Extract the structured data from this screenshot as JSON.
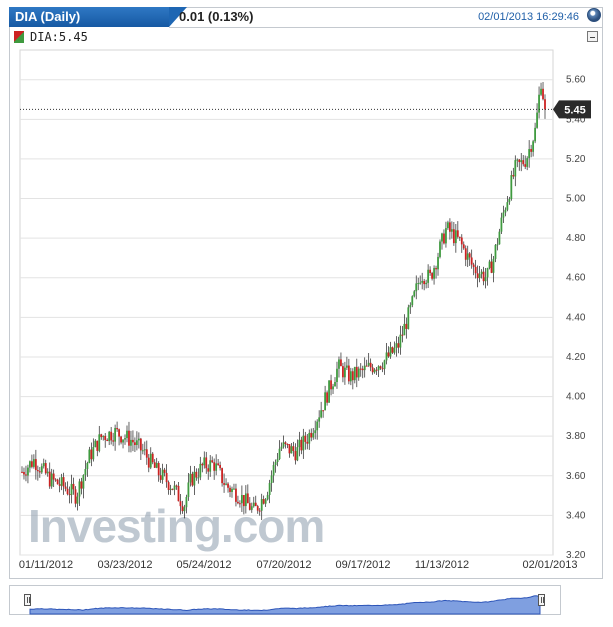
{
  "header": {
    "tab_title": "DIA (Daily)",
    "change": "0.01 (0.13%)",
    "timestamp": "02/01/2013 16:29:46"
  },
  "legend": {
    "label": "DIA:5.45"
  },
  "watermark": "Investing.com",
  "chart_data": {
    "type": "candlestick",
    "series_name": "DIA",
    "last_price_label": "5.45",
    "last_price": 5.45,
    "ylim": [
      3.2,
      5.7
    ],
    "y_ticks": [
      "3.20",
      "3.40",
      "3.60",
      "3.80",
      "4.00",
      "4.20",
      "4.40",
      "4.60",
      "4.80",
      "5.00",
      "5.20",
      "5.40",
      "5.60"
    ],
    "x_tick_labels": [
      "01/11/2012",
      "03/23/2012",
      "05/24/2012",
      "07/20/2012",
      "09/17/2012",
      "11/13/2012",
      "02/01/2013"
    ],
    "grid": "horizontal",
    "up_color": "#3f9a3f",
    "down_color": "#cc2222",
    "approx_close_series": [
      [
        "2012-01-11",
        3.62
      ],
      [
        "2012-01-20",
        3.68
      ],
      [
        "2012-02-01",
        3.58
      ],
      [
        "2012-02-10",
        3.55
      ],
      [
        "2012-02-20",
        3.5
      ],
      [
        "2012-03-01",
        3.7
      ],
      [
        "2012-03-10",
        3.8
      ],
      [
        "2012-03-20",
        3.82
      ],
      [
        "2012-04-01",
        3.78
      ],
      [
        "2012-04-10",
        3.72
      ],
      [
        "2012-04-20",
        3.62
      ],
      [
        "2012-05-01",
        3.55
      ],
      [
        "2012-05-10",
        3.45
      ],
      [
        "2012-05-15",
        3.58
      ],
      [
        "2012-05-24",
        3.65
      ],
      [
        "2012-06-01",
        3.66
      ],
      [
        "2012-06-10",
        3.55
      ],
      [
        "2012-06-20",
        3.5
      ],
      [
        "2012-07-01",
        3.42
      ],
      [
        "2012-07-10",
        3.52
      ],
      [
        "2012-07-20",
        3.75
      ],
      [
        "2012-08-01",
        3.72
      ],
      [
        "2012-08-10",
        3.8
      ],
      [
        "2012-08-20",
        3.95
      ],
      [
        "2012-09-01",
        4.15
      ],
      [
        "2012-09-10",
        4.1
      ],
      [
        "2012-09-17",
        4.12
      ],
      [
        "2012-09-25",
        4.15
      ],
      [
        "2012-10-05",
        4.18
      ],
      [
        "2012-10-15",
        4.25
      ],
      [
        "2012-10-25",
        4.45
      ],
      [
        "2012-11-01",
        4.62
      ],
      [
        "2012-11-08",
        4.6
      ],
      [
        "2012-11-13",
        4.7
      ],
      [
        "2012-11-20",
        4.85
      ],
      [
        "2012-11-30",
        4.78
      ],
      [
        "2012-12-10",
        4.65
      ],
      [
        "2012-12-20",
        4.6
      ],
      [
        "2012-12-25",
        4.7
      ],
      [
        "2013-01-02",
        4.95
      ],
      [
        "2013-01-10",
        5.15
      ],
      [
        "2013-01-18",
        5.2
      ],
      [
        "2013-01-25",
        5.35
      ],
      [
        "2013-01-29",
        5.6
      ],
      [
        "2013-02-01",
        5.45
      ]
    ]
  }
}
